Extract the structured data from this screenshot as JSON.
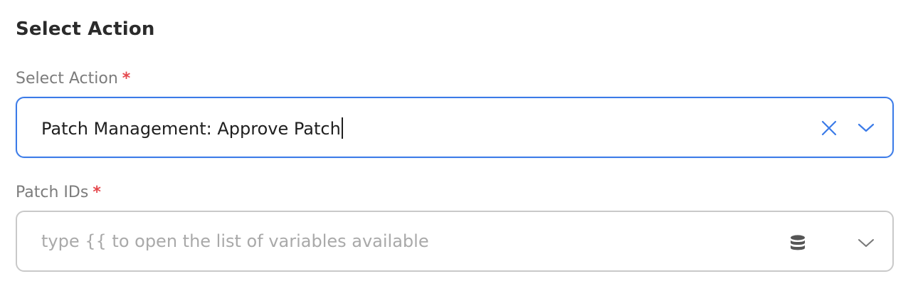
{
  "section": {
    "title": "Select Action"
  },
  "fields": {
    "action": {
      "label": "Select Action",
      "required_mark": "*",
      "value": "Patch Management: Approve Patch"
    },
    "patch_ids": {
      "label": "Patch IDs",
      "required_mark": "*",
      "placeholder": "type {{ to open the list of variables available"
    }
  },
  "colors": {
    "focus_border": "#3b7be8",
    "icon_accent": "#3b7be8",
    "required": "#e5484d",
    "border": "#c9c9c9"
  },
  "icons": {
    "clear": "close-icon",
    "dropdown": "chevron-down-icon",
    "variables": "database-icon"
  }
}
